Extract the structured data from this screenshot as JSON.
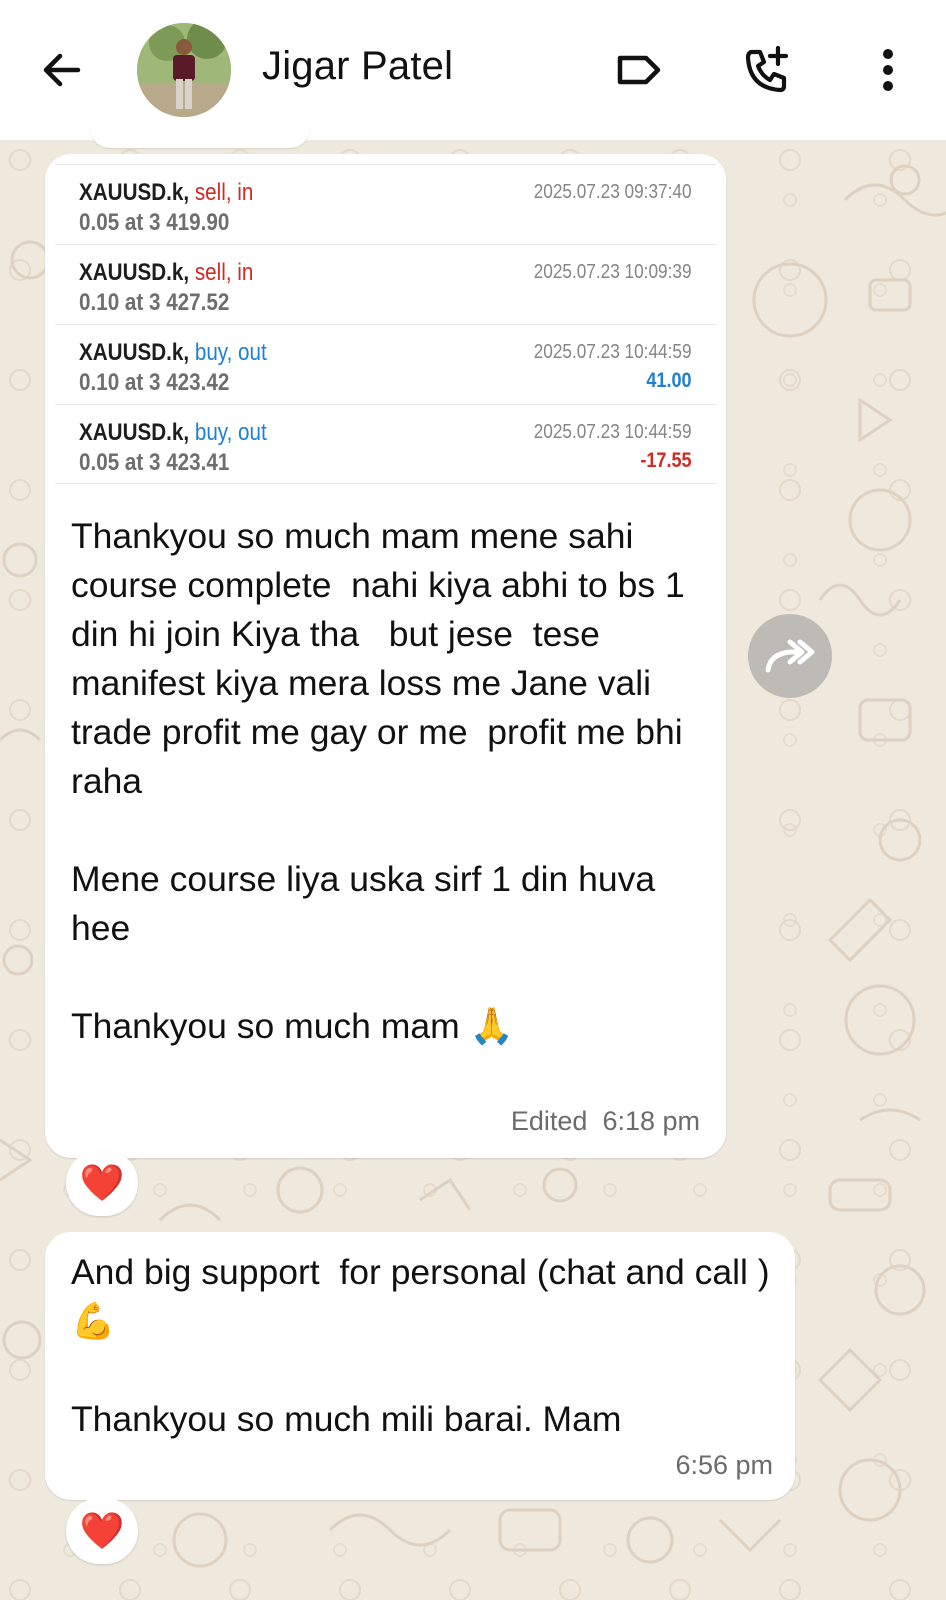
{
  "header": {
    "title": "Jigar Patel",
    "icons": [
      "back-arrow-icon",
      "avatar",
      "label-icon",
      "add-call-icon",
      "more-vert-icon"
    ]
  },
  "trades": [
    {
      "symbol": "XAUUSD.k,",
      "action": "sell, in",
      "detail": "0.05 at 3 419.90",
      "time": "2025.07.23 09:37:40",
      "pnl": ""
    },
    {
      "symbol": "XAUUSD.k,",
      "action": "sell, in",
      "detail": "0.10 at 3 427.52",
      "time": "2025.07.23 10:09:39",
      "pnl": ""
    },
    {
      "symbol": "XAUUSD.k,",
      "action": "buy, out",
      "detail": "0.10 at 3 423.42",
      "time": "2025.07.23 10:44:59",
      "pnl": "41.00"
    },
    {
      "symbol": "XAUUSD.k,",
      "action": "buy, out",
      "detail": "0.05 at 3 423.41",
      "time": "2025.07.23 10:44:59",
      "pnl": "-17.55"
    }
  ],
  "messages": [
    {
      "text": "Thankyou so much mam mene sahi course complete  nahi kiya abhi to bs 1 din hi join Kiya tha   but jese  tese manifest kiya mera loss me Jane vali trade profit me gay or me  profit me bhi raha\n\nMene course liya uska sirf 1 din huva hee\n\nThankyou so much mam 🙏",
      "edited": "Edited",
      "time": "6:18 pm",
      "reaction": "❤️"
    },
    {
      "text": "And big support  for personal (chat and call ) 💪\n\nThankyou so much mili barai. Mam",
      "time": "6:56 pm",
      "reaction": "❤️"
    }
  ],
  "colors": {
    "sell": "#d22a22",
    "buy": "#1f7fd4",
    "wallpaper": "#efe8dd",
    "bubble": "#ffffff"
  }
}
